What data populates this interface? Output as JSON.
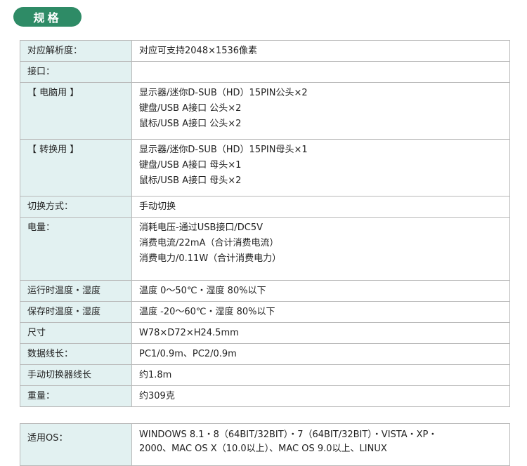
{
  "header": {
    "title": "规格"
  },
  "spec": {
    "resolution": {
      "label": "对应解析度：",
      "value": "对应可支持2048×1536像素"
    },
    "interface": {
      "label": "接口："
    },
    "pc": {
      "label": "【 电脑用 】",
      "lines": [
        "显示器/迷你D-SUB（HD）15PIN公头×2",
        "键盘/USB A接口 公头×2",
        "鼠标/USB A接口 公头×2"
      ]
    },
    "convert": {
      "label": "【 转换用 】",
      "lines": [
        "显示器/迷你D-SUB（HD）15PIN母头×1",
        "键盘/USB A接口 母头×1",
        "鼠标/USB A接口 母头×2"
      ]
    },
    "switch_mode": {
      "label": "切换方式：",
      "value": "手动切换"
    },
    "power": {
      "label": "电量：",
      "lines": [
        "消耗电压-通过USB接口/DC5V",
        "消费电流/22mA（合计消费电流）",
        "消费电力/0.11W（合计消费电力）"
      ]
    },
    "op_temp": {
      "label": "运行时温度・湿度",
      "value": "温度 0～50℃・湿度 80%以下"
    },
    "storage_temp": {
      "label": "保存时温度・湿度",
      "value": "温度 -20～60℃・湿度 80%以下"
    },
    "size": {
      "label": "尺寸",
      "value": "W78×D72×H24.5mm"
    },
    "cable_length": {
      "label": "数据线长：",
      "value": "PC1/0.9m、PC2/0.9m"
    },
    "switcher_cable": {
      "label": "手动切换器线长",
      "value": "约1.8m"
    },
    "weight": {
      "label": "重量：",
      "value": "约309克"
    }
  },
  "os": {
    "label": "适用OS：",
    "line1": "WINDOWS 8.1・8（64BIT/32BIT）・7（64BIT/32BIT）・VISTA・XP・",
    "line2": "2000、MAC OS X（10.0以上）、MAC OS 9.0以上、LINUX"
  }
}
